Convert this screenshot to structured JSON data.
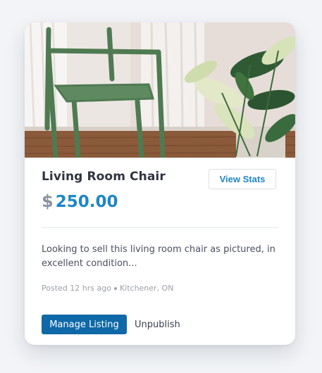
{
  "listing": {
    "title": "Living Room Chair",
    "currency_symbol": "$",
    "price": "250.00",
    "description": "Looking to sell this living room chair as pictured, in excellent condition...",
    "posted": "Posted 12 hrs ago",
    "location": "Kitchener, ON"
  },
  "actions": {
    "view_stats_label": "View Stats",
    "manage_label": "Manage Listing",
    "unpublish_label": "Unpublish"
  },
  "colors": {
    "accent": "#1f86c6",
    "primary_button": "#0f69a8",
    "chair": "#4f7a52",
    "floor": "#8a5a3a"
  }
}
